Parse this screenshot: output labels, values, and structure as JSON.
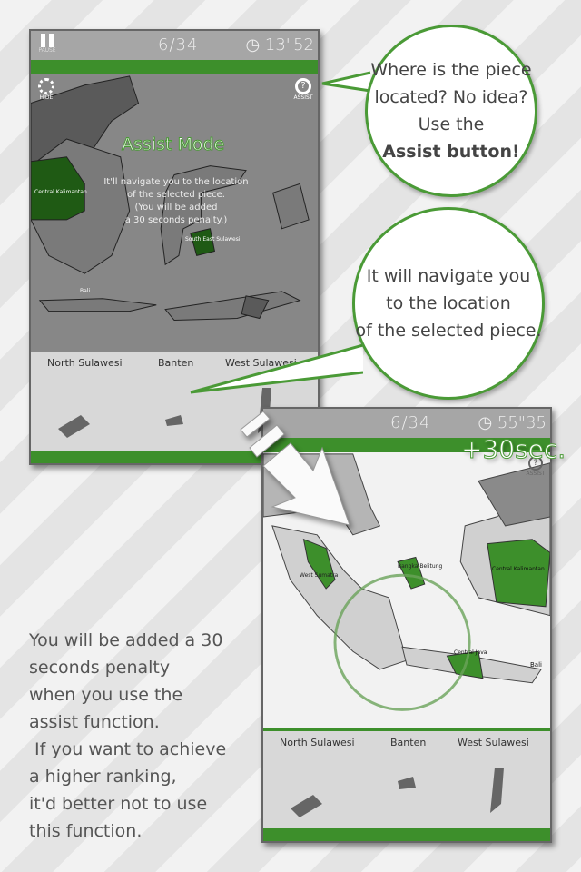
{
  "screen1": {
    "pause_label": "PAUSE",
    "counter": "6/34",
    "timer": "13\"52",
    "hide_label": "HIDE",
    "assist_label": "ASSIST",
    "assist_title": "Assist Mode",
    "assist_desc": [
      "It'll navigate you to the location",
      "of the selected piece.",
      "(You will be added",
      "a 30 seconds penalty.)"
    ],
    "map_labels": [
      "Central Kalimantan",
      "South East Sulawesi",
      "Bali"
    ],
    "tray": [
      "North Sulawesi",
      "Banten",
      "West Sulawesi"
    ]
  },
  "screen2": {
    "counter": "6/34",
    "timer": "55\"35",
    "assist_label": "ASSIST",
    "penalty": "+30sec.",
    "map_labels": [
      "West Sumatra",
      "Bangka-Belitung",
      "Central Kalimantan",
      "Central Java",
      "Bali"
    ],
    "tray": [
      "North Sulawesi",
      "Banten",
      "West Sulawesi"
    ]
  },
  "bubble1": {
    "lines": [
      "Where is the piece",
      "located? No idea?",
      "Use the"
    ],
    "bold": "Assist button!"
  },
  "bubble2": {
    "lines": [
      "It will navigate you",
      "to the location",
      "of the selected piece."
    ]
  },
  "side_text": "You will be added a 30\nseconds penalty\nwhen you use the\nassist function.\n If you want to achieve\na higher ranking,\nit'd better not to use\nthis function.",
  "colors": {
    "accent": "#3d8f2b",
    "map_dark": "#1f5a14"
  }
}
